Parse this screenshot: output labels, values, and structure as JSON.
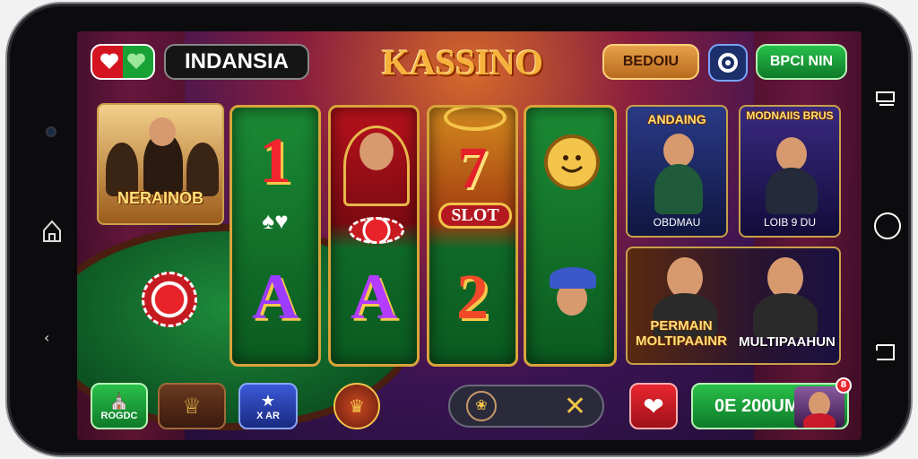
{
  "header": {
    "left_title": "INDANSIA",
    "logo": "KASSINO",
    "bonus_label": "BEDOIU",
    "play_label": "BPCI NIN"
  },
  "reels": {
    "col1": {
      "top": "1",
      "bottom": "A"
    },
    "col2": {
      "bottom": "A"
    },
    "col3": {
      "top": "7",
      "badge": "SLOT",
      "bottom": "2"
    }
  },
  "left_banner": {
    "title": "NERAINOB"
  },
  "cards": [
    {
      "title": "ANDAING",
      "label": "OBDMAU"
    },
    {
      "title": "MODNAIIS BRUS",
      "label": "LOIB 9 DU"
    }
  ],
  "wide_card": {
    "left_title": "PERMAIN MOLTIPAAINR",
    "right_title": "MULTIPAAHUN"
  },
  "bottom_bar": {
    "btn1_label": "ROGDC",
    "btn3_label": "X AR",
    "win_label": "0E 200UM",
    "notif_count": "8"
  },
  "colors": {
    "gold": "#d8a43a",
    "green_btn": "#1ea83a",
    "red_btn": "#d3161f",
    "blue_btn": "#2c4fb8"
  }
}
